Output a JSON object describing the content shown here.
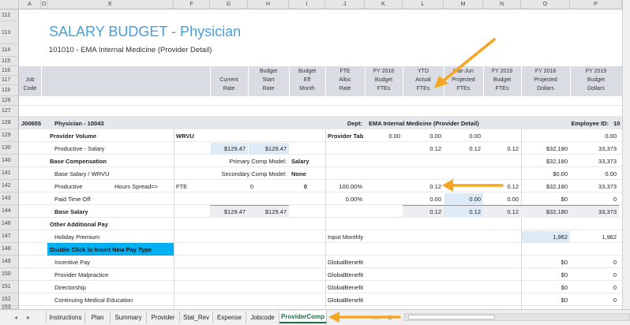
{
  "columns": [
    "A",
    "D",
    "E",
    "F",
    "G",
    "H",
    "I",
    "J",
    "K",
    "L",
    "M",
    "N",
    "O",
    "P"
  ],
  "rows": [
    "112",
    "113",
    "114",
    "115",
    "116",
    "117",
    "118",
    "126",
    "127",
    "128",
    "129",
    "130",
    "140",
    "141",
    "142",
    "143",
    "144",
    "146",
    "147",
    "148",
    "149",
    "150",
    "151",
    "152",
    "153"
  ],
  "title": "SALARY BUDGET - Physician",
  "subtitle": "101010 - EMA Internal Medicine (Provider Detail)",
  "header": {
    "job_code": [
      "Job",
      "Code"
    ],
    "current_rate": [
      "Current",
      "Rate"
    ],
    "budget_start_rate": [
      "Budget",
      "Start",
      "Rate"
    ],
    "budget_eff_month": [
      "Budget",
      "Eff",
      "Month"
    ],
    "fte_alloc_rate": [
      "FTE",
      "Alloc",
      "Rate"
    ],
    "fy2018_budget_ftes": [
      "FY 2018",
      "Budget",
      "FTEs"
    ],
    "ytd_actual_ftes": [
      "YTD",
      "Actual",
      "FTEs"
    ],
    "mar_jun_projected_ftes": [
      "Mar-Jun",
      "Projected",
      "FTEs"
    ],
    "fy2019_budget_ftes": [
      "FY 2019",
      "Budget",
      "FTEs"
    ],
    "fy2018_projected_dollars": [
      "FY 2018",
      "Projected",
      "Dollars"
    ],
    "fy2019_budget_dollars": [
      "FY 2019",
      "Budget",
      "Dollars"
    ]
  },
  "rowdata": {
    "r128": {
      "code": "J00655",
      "name": "Physician - 10043",
      "dept_label": "Dept:",
      "dept_value": "EMA Internal Medicine (Provider Detail)",
      "emp_label": "Employee ID:",
      "emp_value": "10"
    },
    "r129": {
      "label": "Provider Volume",
      "wrvu": "WRVU",
      "tab": "Provider Tab",
      "k": "0.00",
      "l": "0.00",
      "m": "0.00",
      "p": "0.00"
    },
    "r130": {
      "label": "Productive - Salary",
      "g": "$129.47",
      "h": "$129.47",
      "l": "0.12",
      "m": "0.12",
      "n": "0.12",
      "o": "$32,180",
      "p": "33,373"
    },
    "r140": {
      "label": "Base Compensation",
      "model_label": "Primary Comp Model:",
      "model_value": "Salary",
      "o": "$32,180",
      "p": "33,373"
    },
    "r141": {
      "label": "Base Salary / WRVU",
      "model_label": "Secondary Comp Model:",
      "model_value": "None",
      "o": "$0.00",
      "p": "0.00"
    },
    "r142": {
      "label": "Productive",
      "spread": "Hours Spread=>",
      "fte": "FTE",
      "h": "0",
      "i": "0",
      "j": "100.00%",
      "l": "0.12",
      "n": "0.12",
      "o": "$32,180",
      "p": "33,373"
    },
    "r143": {
      "label": "Paid Time Off",
      "j": "0.00%",
      "l": "0.00",
      "m": "0.00",
      "n": "0.00",
      "o": "$0",
      "p": "0"
    },
    "r144": {
      "label": "Base Salary",
      "g": "$129.47",
      "h": "$129.47",
      "l": "0.12",
      "m": "0.12",
      "n": "0.12",
      "o": "$32,180",
      "p": "33,373"
    },
    "r146": {
      "label": "Other Additional Pay"
    },
    "r147": {
      "label": "Holiday Premium",
      "j": "Input Monthly",
      "o": "1,962",
      "p": "1,962"
    },
    "r148": {
      "label": "Double Click to Insert New Pay Type"
    },
    "r149": {
      "label": "Incentive Pay",
      "j": "GlobalBenefit",
      "o": "$0",
      "p": "0"
    },
    "r150": {
      "label": "Provider Malpractice",
      "j": "GlobalBenefit",
      "o": "$0",
      "p": "0"
    },
    "r151": {
      "label": "Directorship",
      "j": "GlobalBenefit",
      "o": "$0",
      "p": "0"
    },
    "r152": {
      "label": "Continuing Medical Education",
      "j": "GlobalBenefit",
      "o": "$0",
      "p": "0"
    }
  },
  "tabs": [
    "Instructions",
    "Plan",
    "Summary",
    "Provider",
    "Stat_Rev",
    "Expense",
    "Jobcode",
    "ProviderComp"
  ],
  "active_tab": "ProviderComp",
  "nav": {
    "prev": "◂",
    "next": "▸",
    "more": "…",
    "add": "⊕"
  },
  "colors": {
    "title": "#4a9fd8",
    "header_band": "#d9dde3",
    "input_cell": "#ddebf7",
    "insert_bar": "#00b0f0",
    "arrow": "#f5a623",
    "active_tab": "#1d7144"
  }
}
